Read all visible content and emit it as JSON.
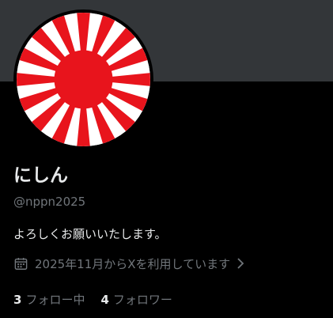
{
  "profile": {
    "display_name": "にしん",
    "handle": "@nppn2025",
    "bio": "よろしくお願いいたします。",
    "joined": "2025年11月からXを利用しています",
    "following_count": "3",
    "following_label": "フォロー中",
    "followers_count": "4",
    "followers_label": "フォロワー"
  },
  "icons": {
    "calendar": "calendar-icon",
    "chevron": "chevron-right-icon"
  },
  "colors": {
    "background": "#000000",
    "banner": "#333639",
    "primary_text": "#e7e9ea",
    "secondary_text": "#71767b",
    "avatar_red": "#e8141c",
    "avatar_white": "#ffffff"
  }
}
